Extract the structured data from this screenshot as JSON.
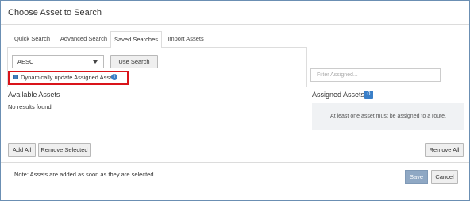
{
  "dialog": {
    "title": "Choose Asset to Search"
  },
  "tabs": [
    {
      "label": "Quick Search",
      "active": false
    },
    {
      "label": "Advanced Search",
      "active": false
    },
    {
      "label": "Saved Searches",
      "active": true
    },
    {
      "label": "Import Assets",
      "active": false
    }
  ],
  "saved_search": {
    "selected_value": "AESC",
    "use_search_label": "Use Search",
    "dynamic_update_label": "Dynamically update Assigned Assets",
    "dynamic_update_checked": true,
    "info_glyph": "i"
  },
  "available": {
    "title": "Available Assets",
    "empty_text": "No results found",
    "add_all_label": "Add All",
    "remove_selected_label": "Remove Selected"
  },
  "assigned": {
    "filter_placeholder": "Filter Assigned...",
    "title": "Assigned Assets",
    "count": "0",
    "message": "At least one asset must be assigned to a route.",
    "remove_all_label": "Remove All"
  },
  "footer": {
    "note": "Note: Assets are added as soon as they are selected.",
    "save_label": "Save",
    "cancel_label": "Cancel"
  },
  "colors": {
    "accent": "#3a7fc8",
    "highlight_border": "#d9141a",
    "save_disabled": "#8fa8c4"
  },
  "icons": {
    "info": "info-icon",
    "dropdown": "chevron-down-icon"
  }
}
